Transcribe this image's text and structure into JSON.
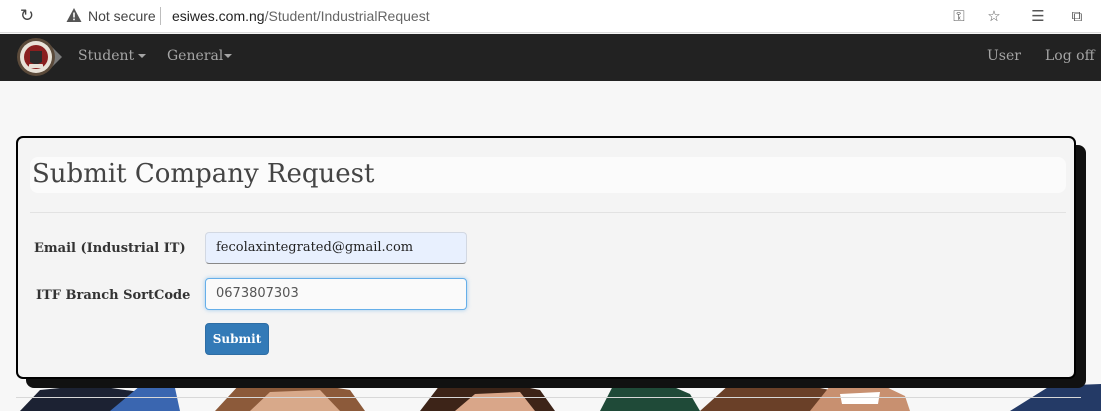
{
  "browser": {
    "security_label": "Not secure",
    "url_host": "esiwes.com.ng",
    "url_path": "/Student/IndustrialRequest",
    "icons": [
      "reload-icon",
      "warning-icon",
      "key-icon",
      "favorite-icon",
      "collections-icon",
      "reading-list-icon"
    ]
  },
  "navbar": {
    "logo_icon": "school-crest-icon",
    "menus": [
      {
        "label": "Student"
      },
      {
        "label": "General"
      }
    ],
    "right": [
      {
        "label": "User"
      },
      {
        "label": "Log off"
      }
    ],
    "bg_color": "#222222"
  },
  "form": {
    "title": "Submit Company Request",
    "email": {
      "label": "Email (Industrial IT)",
      "value": "fecolaxintegrated@gmail.com"
    },
    "sortcode": {
      "label": "ITF Branch SortCode",
      "value": "0673807303"
    },
    "submit_label": "Submit",
    "accent_color": "#337ab7"
  }
}
